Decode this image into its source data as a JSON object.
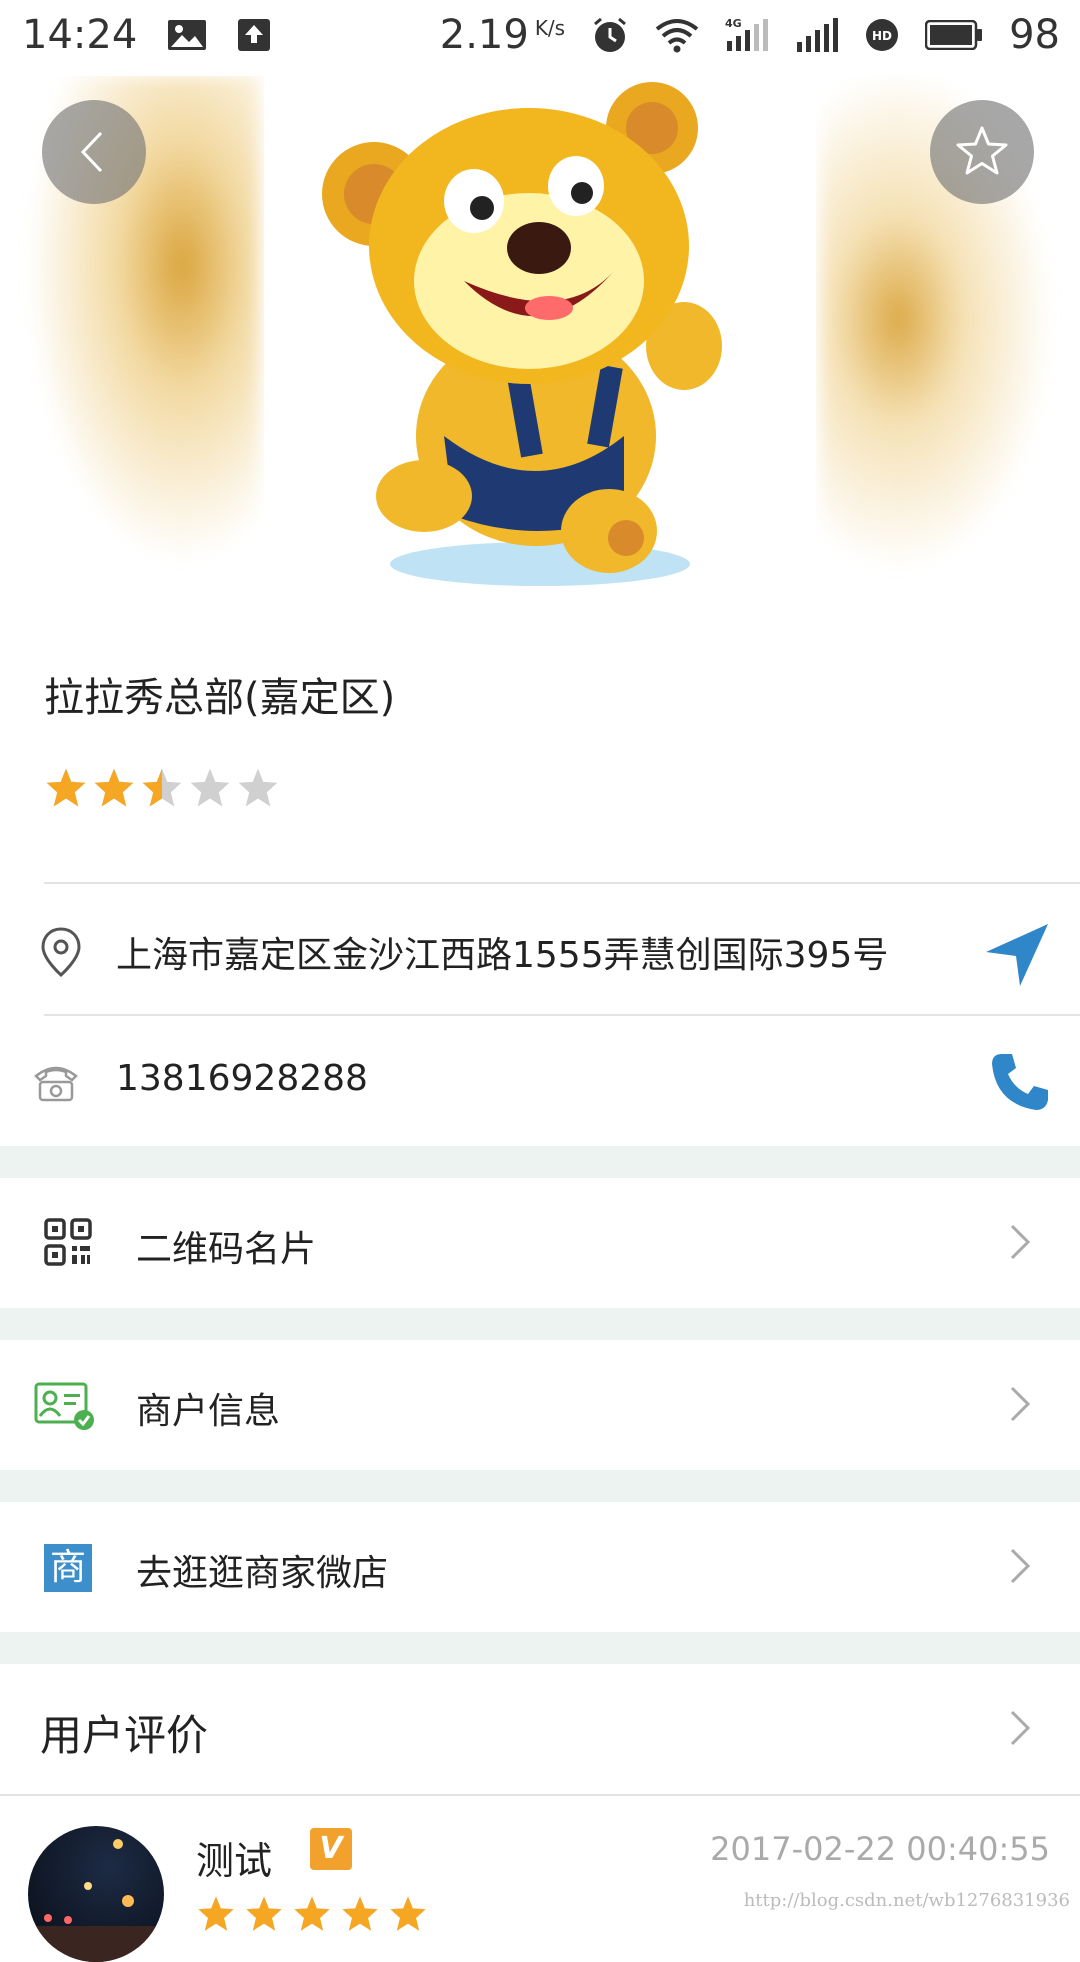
{
  "status_bar": {
    "time": "14:24",
    "net_speed": "2.19",
    "net_unit": "K/s",
    "battery": "98"
  },
  "shop": {
    "name": "拉拉秀总部(嘉定区)",
    "rating": 2.5,
    "rating_max": 5,
    "address": "上海市嘉定区金沙江西路1555弄慧创国际395号",
    "phone": "13816928288"
  },
  "menu": {
    "qr_card": "二维码名片",
    "merchant_info": "商户信息",
    "micro_shop": "去逛逛商家微店",
    "reviews": "用户评价"
  },
  "shop_icon_char": "商",
  "review": {
    "user": "测试",
    "vip_badge": "V",
    "date": "2017-02-22 00:40:55",
    "rating": 5
  },
  "watermark": "http://blog.csdn.net/wb1276831936",
  "colors": {
    "accent_blue": "#2f86c8",
    "star_gold": "#f5a623",
    "star_grey": "#d0d0d0",
    "section_gap": "#edf3f0"
  }
}
